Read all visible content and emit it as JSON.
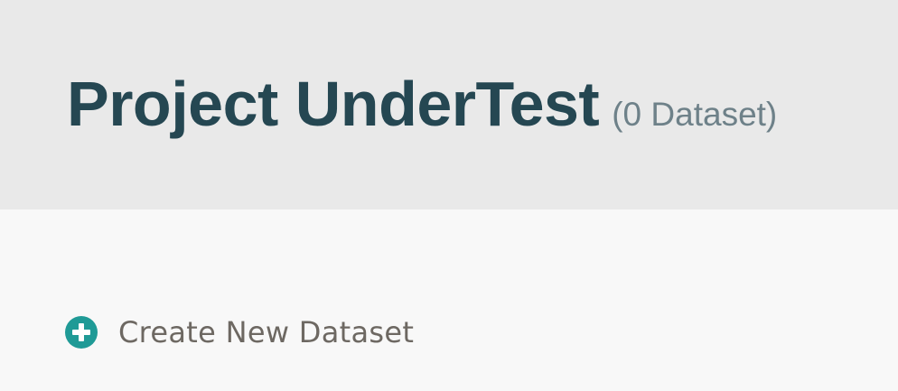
{
  "header": {
    "title": "Project UnderTest",
    "dataset_count": "(0 Dataset)"
  },
  "actions": {
    "create_dataset_label": "Create New Dataset",
    "create_dataset_icon": "plus-circle-icon"
  },
  "colors": {
    "header_bg": "#e9e9e9",
    "body_bg": "#f8f8f8",
    "title": "#254752",
    "count": "#6e8189",
    "accent": "#1f9a96",
    "link_text": "#6d6862"
  }
}
